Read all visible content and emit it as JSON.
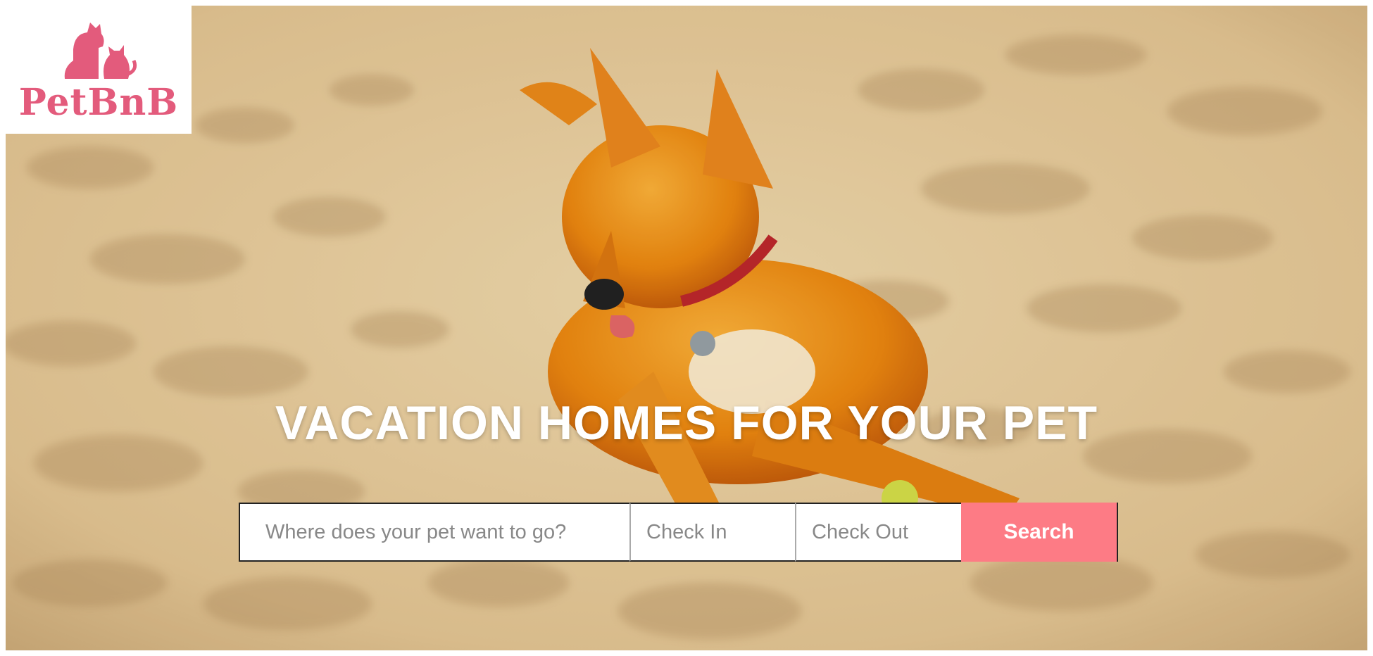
{
  "brand": {
    "name": "PetBnB",
    "logo_icon": "dog-and-cat-icon",
    "color": "#e35b7c"
  },
  "hero": {
    "headline": "VACATION HOMES FOR YOUR PET",
    "image_subject": "dog-on-beach-sand"
  },
  "search": {
    "where_placeholder": "Where does your pet want to go?",
    "checkin_placeholder": "Check In",
    "checkout_placeholder": "Check Out",
    "button_label": "Search",
    "button_color": "#fd7b85"
  }
}
